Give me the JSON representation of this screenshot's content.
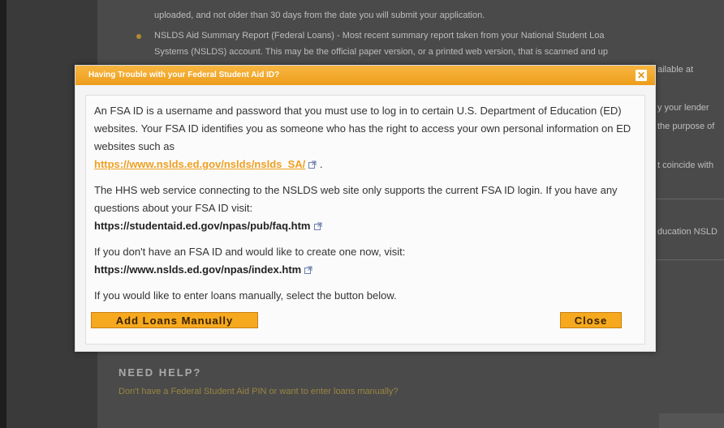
{
  "background": {
    "line1": "uploaded, and not older than 30 days from the date you will submit your application.",
    "line2": "NSLDS Aid Summary Report (Federal Loans) - Most recent summary report taken from your National Student Loa",
    "line3": "Systems (NSLDS) account. This may be the official paper version, or a printed web version, that is scanned and up",
    "right_fragment_1": "ailable at",
    "right_fragment_2": "y your lender",
    "right_fragment_3": "the purpose of",
    "right_fragment_4": "t coincide with",
    "right_fragment_5": "ducation NSLD",
    "help_title": "NEED HELP?",
    "help_link": "Don't have a Federal Student Aid PIN or want to enter loans manually?"
  },
  "modal": {
    "title": "Having Trouble with your Federal Student Aid ID?",
    "close_x": "✕",
    "para1_text": "An FSA ID is a username and password that you must use to log in to certain U.S. Department of Education (ED) websites. Your FSA ID identifies you as someone who has the right to access your own personal information on ED websites such as",
    "para1_link": "https://www.nslds.ed.gov/nslds/nslds_SA/",
    "para1_end": ".",
    "para2_text": "The HHS web service connecting to the NSLDS web site only supports the current FSA ID login. If you have any questions about your FSA ID visit:",
    "para2_link": "https://studentaid.ed.gov/npas/pub/faq.htm",
    "para3_text": "If you don't have an FSA ID and would like to create one now, visit:",
    "para3_link": "https://www.nslds.ed.gov/npas/index.htm",
    "para4_text": "If you would like to enter loans manually, select the button below.",
    "add_button": "Add Loans Manually",
    "close_button": "Close"
  },
  "colors": {
    "accent": "#f6a91f",
    "link_orange": "#f0a020"
  }
}
